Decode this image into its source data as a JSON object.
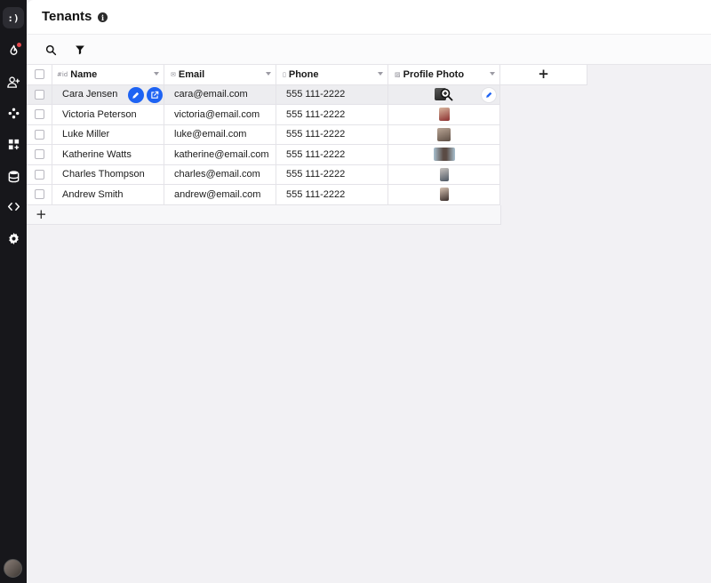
{
  "app": {
    "logo_text": ":)"
  },
  "sidebar": {
    "items": [
      {
        "name": "flame-icon"
      },
      {
        "name": "add-user-icon"
      },
      {
        "name": "integrations-icon"
      },
      {
        "name": "apps-icon"
      },
      {
        "name": "database-icon"
      },
      {
        "name": "code-icon"
      },
      {
        "name": "gear-icon"
      }
    ],
    "notification_color": "#e5484d"
  },
  "header": {
    "title": "Tenants",
    "info_glyph": "i"
  },
  "toolbar": {
    "search_icon": "search-icon",
    "filter_icon": "filter-icon"
  },
  "table": {
    "columns": [
      {
        "prefix": "#id",
        "label": "Name"
      },
      {
        "prefix": "✉",
        "label": "Email"
      },
      {
        "prefix": "▯",
        "label": "Phone"
      },
      {
        "prefix": "▨",
        "label": "Profile Photo"
      }
    ],
    "add_column_glyph": "+",
    "add_row_glyph": "+",
    "rows": [
      {
        "name": "Cara Jensen",
        "email": "cara@email.com",
        "phone": "555 111-2222",
        "photo_color": "#3a3a3a"
      },
      {
        "name": "Victoria Peterson",
        "email": "victoria@email.com",
        "phone": "555 111-2222",
        "photo_color": "#8c2f2f"
      },
      {
        "name": "Luke Miller",
        "email": "luke@email.com",
        "phone": "555 111-2222",
        "photo_color": "#7d6a5a"
      },
      {
        "name": "Katherine Watts",
        "email": "katherine@email.com",
        "phone": "555 111-2222",
        "photo_color": "#6f8797"
      },
      {
        "name": "Charles Thompson",
        "email": "charles@email.com",
        "phone": "555 111-2222",
        "photo_color": "#4d5763"
      },
      {
        "name": "Andrew Smith",
        "email": "andrew@email.com",
        "phone": "555 111-2222",
        "photo_color": "#3b2f2c"
      }
    ],
    "accent_color": "#1e63f3"
  }
}
